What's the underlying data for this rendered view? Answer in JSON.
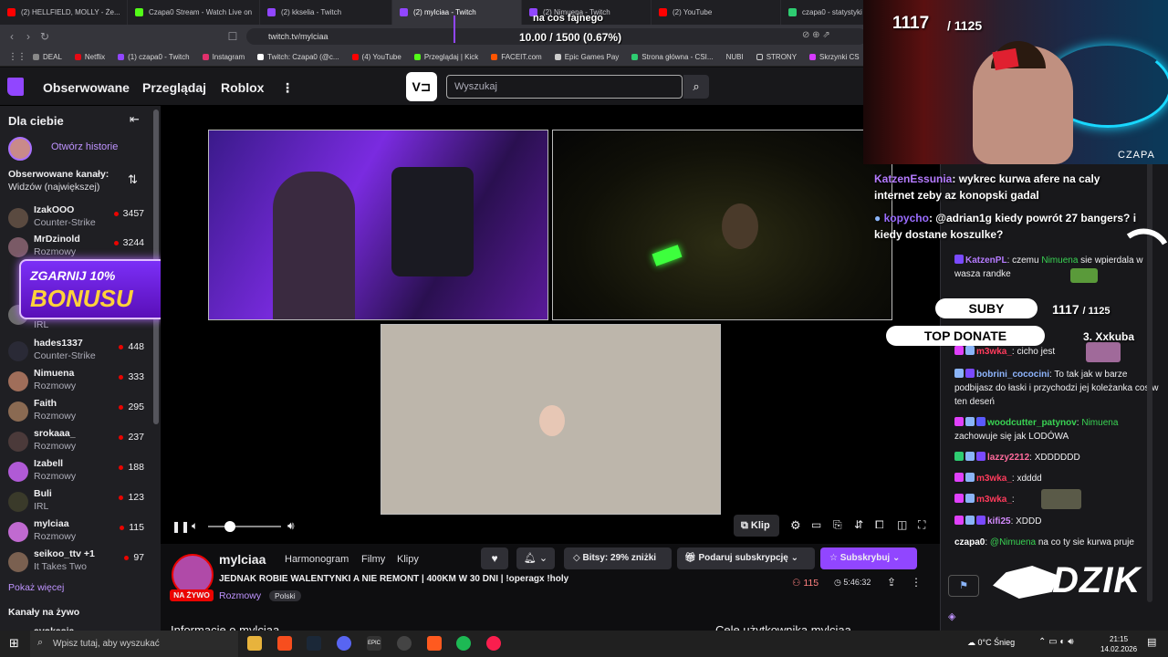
{
  "tabs": [
    {
      "label": "(2) HELLFIELD, MOLLY - Że...",
      "color": "#ff0000"
    },
    {
      "label": "Czapa0 Stream - Watch Live on",
      "color": "#53fc18"
    },
    {
      "label": "(2) kkselia - Twitch",
      "color": "#9146ff"
    },
    {
      "label": "(2) mylciaa - Twitch",
      "color": "#9146ff"
    },
    {
      "label": "(2) Nimuena - Twitch",
      "color": "#9146ff"
    },
    {
      "label": "(2) YouTube",
      "color": "#ff0000"
    },
    {
      "label": "czapa0 - statystyki",
      "color": "#2ecc71"
    }
  ],
  "address": {
    "url": "twitch.tv/mylciaa"
  },
  "bookmarks": [
    "DEAL",
    "Netflix",
    "(1) czapa0 - Twitch",
    "Instagram",
    "Twitch: Czapa0 (@c...",
    "(4) YouTube",
    "Przeglądaj | Kick",
    "FACEIT.com",
    "Epic Games Pay",
    "Strona główna - CSI...",
    "NUBI",
    "STRONY",
    "Skrzynki CS"
  ],
  "twitch": {
    "nav": [
      "Obserwowane",
      "Przeglądaj",
      "Roblox"
    ],
    "search_placeholder": "Wyszukaj"
  },
  "sidebar": {
    "title": "Dla ciebie",
    "stories": "Otwórz historie",
    "followed_title": "Obserwowane kanały:",
    "followed_sort": "Widzów (największej)",
    "channels": [
      {
        "name": "IzakOOO",
        "category": "Counter-Strike",
        "viewers": "3457"
      },
      {
        "name": "MrDzinold",
        "category": "Rozmowy",
        "viewers": "3244"
      },
      {
        "name": "",
        "category": "IRL",
        "viewers": ""
      },
      {
        "name": "hades1337",
        "category": "Counter-Strike",
        "viewers": "448"
      },
      {
        "name": "Nimuena",
        "category": "Rozmowy",
        "viewers": "333"
      },
      {
        "name": "Faith",
        "category": "Rozmowy",
        "viewers": "295"
      },
      {
        "name": "srokaaa_",
        "category": "Rozmowy",
        "viewers": "237"
      },
      {
        "name": "Izabell",
        "category": "Rozmowy",
        "viewers": "188"
      },
      {
        "name": "Buli",
        "category": "IRL",
        "viewers": "123"
      },
      {
        "name": "mylciaa",
        "category": "Rozmowy",
        "viewers": "115"
      },
      {
        "name": "seikoo_ttv +1",
        "category": "It Takes Two",
        "viewers": "97"
      }
    ],
    "show_more": "Pokaż więcej",
    "live_title": "Kanały na żywo",
    "live_first": "avokasia"
  },
  "bonus_banner": {
    "line1": "ZGARNIJ 10%",
    "line2": "BONUSU"
  },
  "player": {
    "clip_label": "Klip"
  },
  "stream": {
    "channel": "mylciaa",
    "tabs": [
      "Harmonogram",
      "Filmy",
      "Klipy"
    ],
    "title": "JEDNAK ROBIE WALENTYNKI A NIE REMONT | 400KM W 30 DNI | !operagx !holy",
    "live": "NA ŻYWO",
    "category": "Rozmowy",
    "tag": "Polski",
    "viewers": "115",
    "uptime": "5:46:32",
    "bits_btn": "Bitsy: 29% zniżki",
    "gift_btn": "Podaruj subskrypcję",
    "sub_btn": "Subskrybuj",
    "about": "Informacje o mylciaa",
    "goals": "Cele użytkownika mylciaa"
  },
  "overlay": {
    "goal_text": "na cos fajnego",
    "goal_value": "10.00 / 1500 (0.67%)",
    "count_big": "1117",
    "count_total": "/ 1125",
    "cam_name": "CZAPA",
    "suby_label": "SUBY",
    "suby_count": "1117",
    "suby_total": "/ 1125",
    "top_donate": "TOP DONATE",
    "top_donate_name": "3. Xxkuba",
    "brand": "DZIK",
    "overlay_msgs": [
      {
        "user": "KatzenEssunia",
        "color": "#b57bff",
        "text": "wykrec kurwa afere na caly internet zeby az konopski gadal"
      },
      {
        "user": "kopycho",
        "color": "#9a6cff",
        "text": "@adrian1g kiedy powrót 27 bangers? i kiedy dostane koszulke?"
      }
    ]
  },
  "chat": [
    {
      "user": "KatzenPL",
      "color": "#b57bff",
      "text": "czemu ",
      "mention": "Nimuena",
      "rest": " sie wpierdala w wasza randke"
    },
    {
      "user": "m3wka_",
      "color": "#ff3b5c",
      "text": "cicho jest"
    },
    {
      "user": "bobrini_cococini",
      "color": "#8fb6ff",
      "text": "To tak jak w barze podbijasz do łaski i przychodzi jej koleżanka cos w ten deseń"
    },
    {
      "user": "woodcutter_patynov",
      "color": "#39d353",
      "text": "",
      "mention": "Nimuena",
      "rest": " zachowuje się jak LODÓWA"
    },
    {
      "user": "lazzy2212",
      "color": "#ff6b9d",
      "text": "XDDDDDD"
    },
    {
      "user": "m3wka_",
      "color": "#ff3b5c",
      "text": "xdddd"
    },
    {
      "user": "m3wka_",
      "color": "#ff3b5c",
      "text": ""
    },
    {
      "user": "kifi25",
      "color": "#d58cff",
      "text": "XDDD"
    },
    {
      "user": "czapa0",
      "color": "#ffffff",
      "text": "",
      "mention": "@Nimuena",
      "rest": " na co ty sie kurwa pruje"
    }
  ],
  "taskbar": {
    "search": "Wpisz tutaj, aby wyszukać",
    "weather": "0°C Śnieg",
    "time": "21:15",
    "date": "14.02.2026"
  }
}
